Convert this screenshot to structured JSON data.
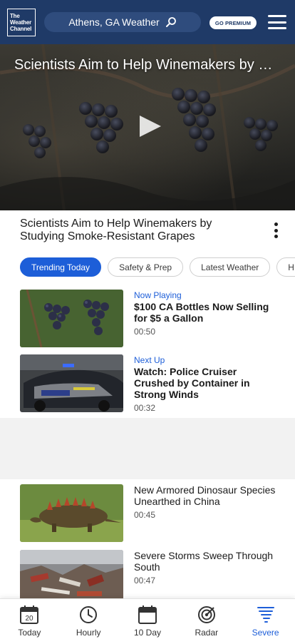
{
  "header": {
    "logo_lines": [
      "The",
      "Weather",
      "Channel"
    ],
    "location_search": "Athens, GA Weather",
    "premium_label": "GO PREMIUM"
  },
  "video": {
    "overlay_title": "Scientists Aim to Help Winemakers by Studying Smoke-Resistant Grapes",
    "title": "Scientists Aim to Help Winemakers by Studying Smoke-Resistant Grapes"
  },
  "tabs": [
    {
      "label": "Trending Today",
      "active": true
    },
    {
      "label": "Safety & Prep",
      "active": false
    },
    {
      "label": "Latest Weather",
      "active": false
    },
    {
      "label": "H",
      "active": false
    }
  ],
  "playlist": [
    {
      "status": "Now Playing",
      "title": "$100 CA Bottles Now Selling for $5 a Gallon",
      "duration": "00:50"
    },
    {
      "status": "Next Up",
      "title": "Watch: Police Cruiser Crushed by Container in Strong Winds",
      "duration": "00:32"
    },
    {
      "status": "",
      "title": "New Armored Dinosaur Species Unearthed in China",
      "duration": "00:45"
    },
    {
      "status": "",
      "title": "Severe Storms Sweep Through South",
      "duration": "00:47"
    }
  ],
  "bottom_nav": [
    {
      "label": "Today",
      "icon": "calendar-day-icon",
      "day": "20"
    },
    {
      "label": "Hourly",
      "icon": "clock-icon"
    },
    {
      "label": "10 Day",
      "icon": "calendar-icon"
    },
    {
      "label": "Radar",
      "icon": "radar-icon"
    },
    {
      "label": "Severe",
      "icon": "tornado-icon",
      "active": true
    }
  ],
  "colors": {
    "header": "#1f3a67",
    "accent": "#1d5ed8"
  }
}
